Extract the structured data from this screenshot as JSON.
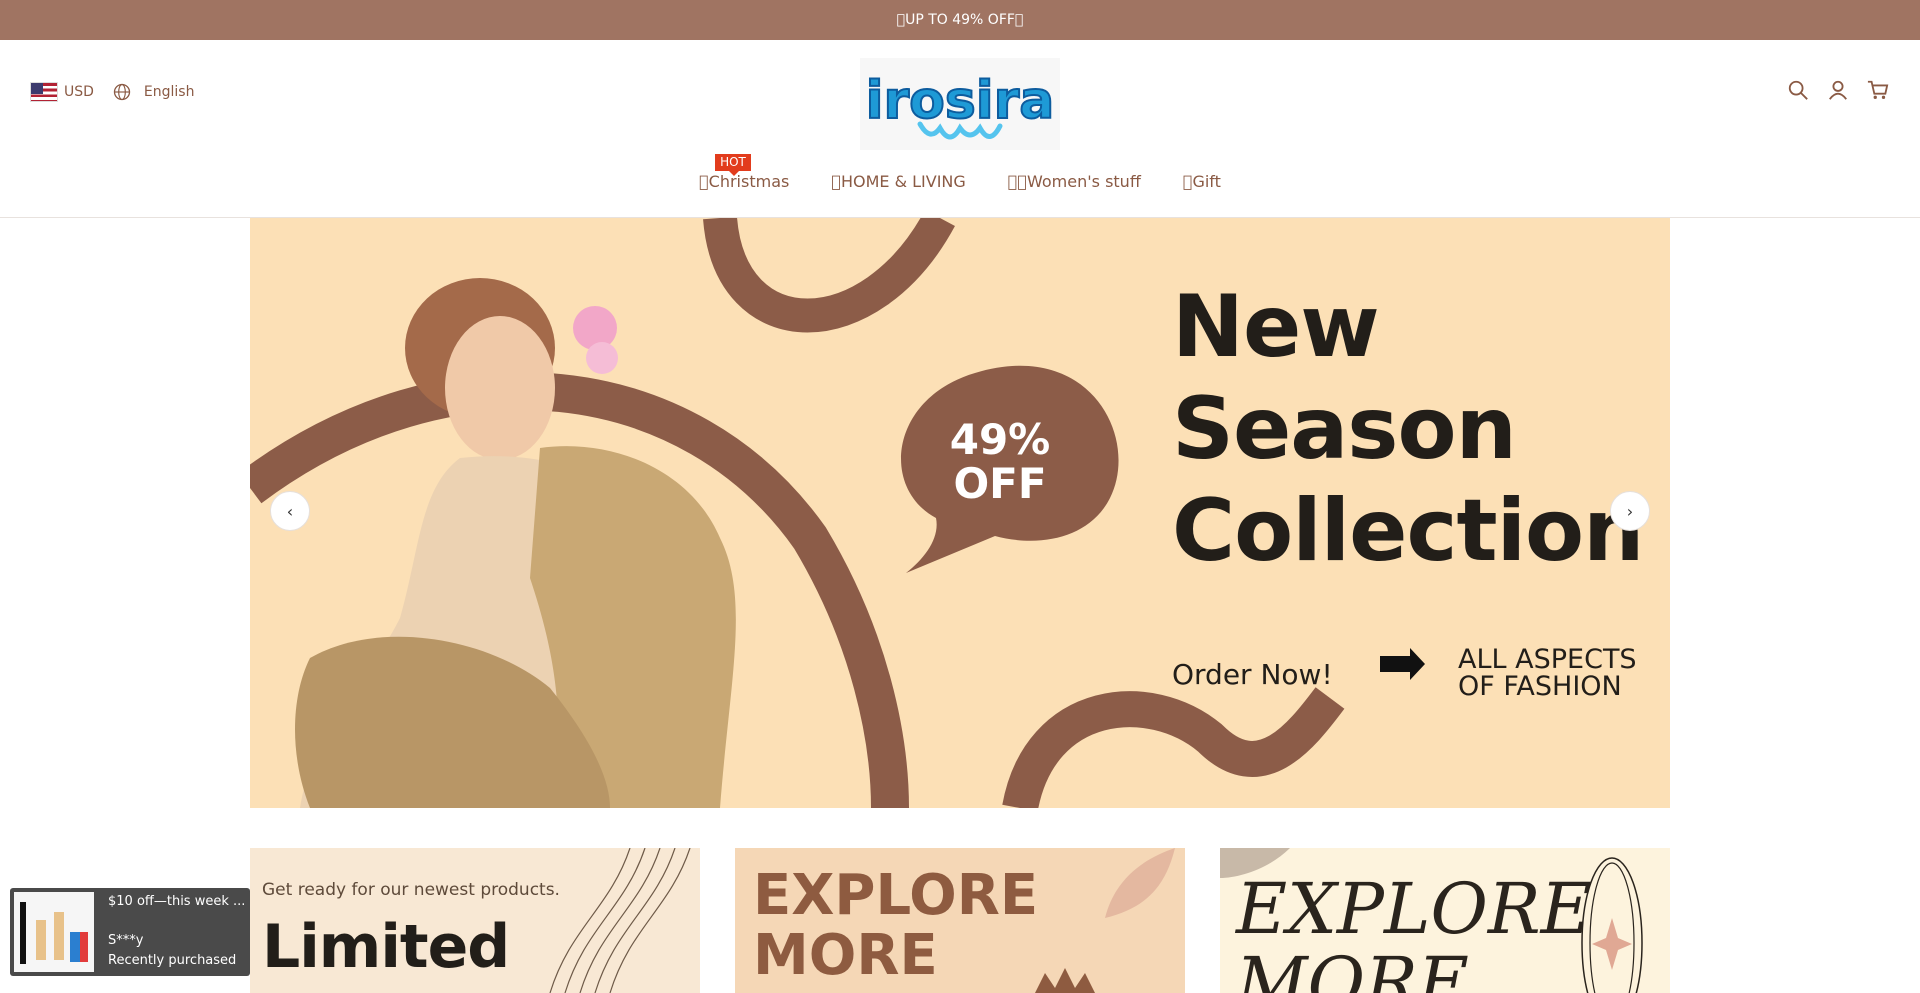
{
  "announcement": {
    "text": "\u0000UP TO 49% OFF\u0000"
  },
  "locale": {
    "currency": "USD",
    "language": "English"
  },
  "brand": {
    "logo_text": "irosira"
  },
  "header_icons": [
    "search-icon",
    "account-icon",
    "cart-icon"
  ],
  "nav": {
    "items": [
      {
        "label": "\u0000Christmas",
        "badge": "HOT"
      },
      {
        "label": "\u0000HOME & LIVING"
      },
      {
        "label": "\u0000\u0000Women's stuff"
      },
      {
        "label": "\u0000Gift"
      }
    ]
  },
  "hero": {
    "title_line1": "New",
    "title_line2": "Season",
    "title_line3": "Collection",
    "discount_line1": "49%",
    "discount_line2": "OFF",
    "order_text": "Order Now!",
    "aspects_line1": "ALL ASPECTS",
    "aspects_line2": "OF FASHION",
    "prev_icon": "chevron-left-icon",
    "next_icon": "chevron-right-icon"
  },
  "cards": [
    {
      "small": "Get ready for our newest products.",
      "big": "Limited"
    },
    {
      "big_line1": "EXPLORE",
      "big_line2": "MORE"
    },
    {
      "big_line1": "EXPLORE",
      "big_line2": "MORE"
    }
  ],
  "toast": {
    "title": "$10 off—this week ...",
    "name": "S***y",
    "subtitle": "Recently purchased"
  },
  "colors": {
    "announcement_bg": "#a07462",
    "hero_bg": "#fce0b6",
    "accent_brown": "#8a5a44",
    "hot_badge": "#e23c1d"
  }
}
